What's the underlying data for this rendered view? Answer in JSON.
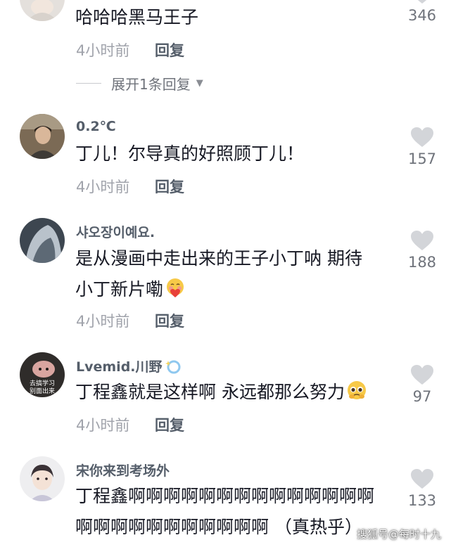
{
  "comments": [
    {
      "content_lines": [
        "哈哈哈黑马王子"
      ],
      "time": "4小时前",
      "reply_label": "回复",
      "likes": "346"
    },
    {
      "username": "0.2℃",
      "content_lines": [
        "丁儿！尔导真的好照顾丁儿！"
      ],
      "time": "4小时前",
      "reply_label": "回复",
      "likes": "157"
    },
    {
      "username": "샤오장이예요.",
      "content_lines": [
        "是从漫画中走出来的王子小丁呐 期待",
        "小丁新片嘞"
      ],
      "time": "4小时前",
      "reply_label": "回复",
      "likes": "188"
    },
    {
      "username": "Lvemid.川野",
      "avatar_text": [
        "去搞学习",
        "别面出来"
      ],
      "content_lines": [
        "丁程鑫就是这样啊 永远都那么努力"
      ],
      "time": "4小时前",
      "reply_label": "回复",
      "likes": "97"
    },
    {
      "username": "宋你来到考场外",
      "content_lines": [
        "丁程鑫啊啊啊啊啊啊啊啊啊啊啊啊啊啊",
        "啊啊啊啊啊啊啊啊啊啊啊 （真热乎）"
      ],
      "likes": "133"
    }
  ],
  "expand_replies": "展开1条回复",
  "watermark": "搜狐号@每时十九",
  "icons": {
    "like": "heart-icon",
    "expand": "caret-down-icon"
  },
  "colors": {
    "text": "#161823",
    "username": "#555e6a",
    "meta": "#a0a3ab",
    "heart": "#d3d5d9"
  }
}
